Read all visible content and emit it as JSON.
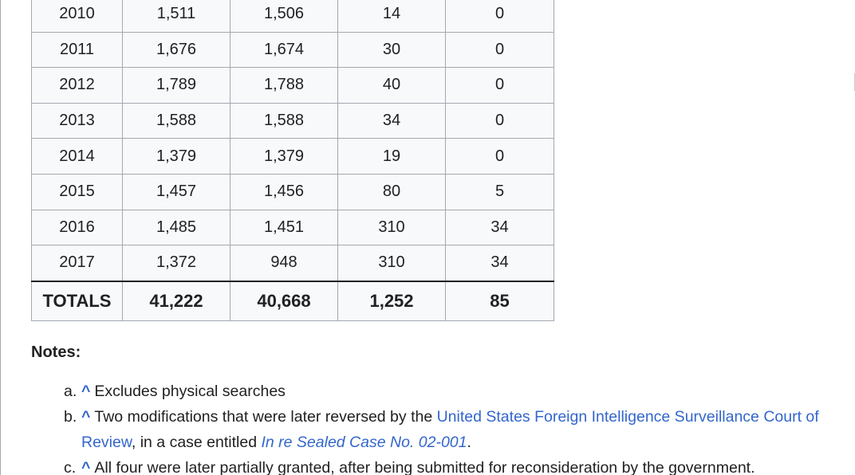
{
  "table": {
    "rows": [
      [
        "2010",
        "1,511",
        "1,506",
        "14",
        "0"
      ],
      [
        "2011",
        "1,676",
        "1,674",
        "30",
        "0"
      ],
      [
        "2012",
        "1,789",
        "1,788",
        "40",
        "0"
      ],
      [
        "2013",
        "1,588",
        "1,588",
        "34",
        "0"
      ],
      [
        "2014",
        "1,379",
        "1,379",
        "19",
        "0"
      ],
      [
        "2015",
        "1,457",
        "1,456",
        "80",
        "5"
      ],
      [
        "2016",
        "1,485",
        "1,451",
        "310",
        "34"
      ],
      [
        "2017",
        "1,372",
        "948",
        "310",
        "34"
      ]
    ],
    "totals": [
      "TOTALS",
      "41,222",
      "40,668",
      "1,252",
      "85"
    ]
  },
  "notes": {
    "heading": "Notes:",
    "caret": "^",
    "items": [
      {
        "marker": "a.",
        "text": "Excludes physical searches"
      },
      {
        "marker": "b.",
        "text_before": "Two modifications that were later reversed by the ",
        "link_text": "United States Foreign Intelligence Surveillance Court of Review",
        "text_middle": ", in a case entitled ",
        "case_link_text": "In re Sealed Case No. 02-001",
        "text_after": "."
      },
      {
        "marker": "c.",
        "text": "All four were later partially granted, after being submitted for reconsideration by the government."
      }
    ]
  }
}
